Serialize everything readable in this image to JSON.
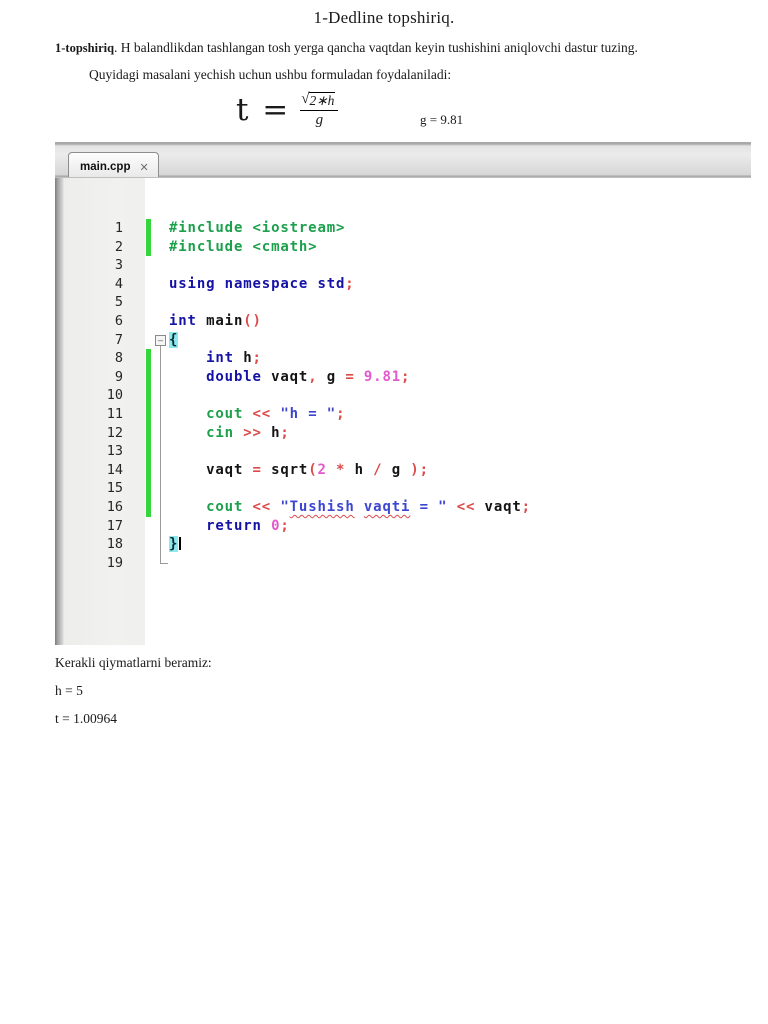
{
  "page": {
    "title": "1-Dedline topshiriq.",
    "task_label": "1-topshiriq",
    "task_text": ". H balandlikdan tashlangan tosh yerga qancha vaqtdan keyin tushishini aniqlovchi dastur tuzing.",
    "hint_text": "Quyidagi masalani yechish uchun ushbu formuladan foydalaniladi:",
    "formula": {
      "lhs": "t =",
      "radical": "√",
      "numerator": "2∗h",
      "denominator": "g",
      "constant": "g = 9.81"
    },
    "results": {
      "intro": "Kerakli qiymatlarni beramiz:",
      "h_value": "h = 5",
      "t_value": "t = 1.00964"
    }
  },
  "ide": {
    "tab": {
      "label": "main.cpp",
      "close_icon": "✕"
    },
    "colors": {
      "preprocessor_green": "#1ca04c",
      "keyword_navy": "#1512a6",
      "operator_red": "#dc4a4a",
      "number_magenta": "#e259ce",
      "string_blue": "#3c46d0",
      "identifier_black": "#141414",
      "brace_highlight_cyan": "#8be9f0",
      "change_bar_green": "#36d53c",
      "gutter_gray": "#f1f1f0"
    },
    "lines": [
      {
        "n": "1",
        "m": true,
        "t": [
          {
            "c": "g",
            "x": "#include <iostream>"
          }
        ]
      },
      {
        "n": "2",
        "m": true,
        "t": [
          {
            "c": "g",
            "x": "#include <cmath>"
          }
        ]
      },
      {
        "n": "3",
        "t": []
      },
      {
        "n": "4",
        "t": [
          {
            "c": "k",
            "x": "using namespace std"
          },
          {
            "c": "o",
            "x": ";"
          }
        ]
      },
      {
        "n": "5",
        "t": []
      },
      {
        "n": "6",
        "t": [
          {
            "c": "k",
            "x": "int"
          },
          {
            "c": "i",
            "x": " main"
          },
          {
            "c": "o",
            "x": "()"
          }
        ]
      },
      {
        "n": "7",
        "f": "box",
        "t": [
          {
            "c": "hl",
            "x": "{"
          }
        ]
      },
      {
        "n": "8",
        "m": true,
        "f": "line",
        "t": [
          {
            "c": "i",
            "x": "    "
          },
          {
            "c": "k",
            "x": "int"
          },
          {
            "c": "i",
            "x": " h"
          },
          {
            "c": "o",
            "x": ";"
          }
        ]
      },
      {
        "n": "9",
        "m": true,
        "f": "line",
        "t": [
          {
            "c": "i",
            "x": "    "
          },
          {
            "c": "k",
            "x": "double"
          },
          {
            "c": "i",
            "x": " vaqt"
          },
          {
            "c": "o",
            "x": ","
          },
          {
            "c": "i",
            "x": " g "
          },
          {
            "c": "o",
            "x": "="
          },
          {
            "c": "i",
            "x": " "
          },
          {
            "c": "n",
            "x": "9.81"
          },
          {
            "c": "o",
            "x": ";"
          }
        ]
      },
      {
        "n": "10",
        "m": true,
        "f": "line",
        "t": []
      },
      {
        "n": "11",
        "m": true,
        "f": "line",
        "t": [
          {
            "c": "i",
            "x": "    "
          },
          {
            "c": "g",
            "x": "cout"
          },
          {
            "c": "i",
            "x": " "
          },
          {
            "c": "o",
            "x": "<<"
          },
          {
            "c": "i",
            "x": " "
          },
          {
            "c": "s",
            "x": "\"h = \""
          },
          {
            "c": "o",
            "x": ";"
          }
        ]
      },
      {
        "n": "12",
        "m": true,
        "f": "line",
        "t": [
          {
            "c": "i",
            "x": "    "
          },
          {
            "c": "g",
            "x": "cin"
          },
          {
            "c": "i",
            "x": " "
          },
          {
            "c": "o",
            "x": ">>"
          },
          {
            "c": "i",
            "x": " h"
          },
          {
            "c": "o",
            "x": ";"
          }
        ]
      },
      {
        "n": "13",
        "m": true,
        "f": "line",
        "t": []
      },
      {
        "n": "14",
        "m": true,
        "f": "line",
        "t": [
          {
            "c": "i",
            "x": "    vaqt "
          },
          {
            "c": "o",
            "x": "="
          },
          {
            "c": "i",
            "x": " sqrt"
          },
          {
            "c": "o",
            "x": "("
          },
          {
            "c": "n",
            "x": "2"
          },
          {
            "c": "i",
            "x": " "
          },
          {
            "c": "o",
            "x": "*"
          },
          {
            "c": "i",
            "x": " h "
          },
          {
            "c": "o",
            "x": "/"
          },
          {
            "c": "i",
            "x": " g "
          },
          {
            "c": "o",
            "x": ")"
          },
          {
            "c": "o",
            "x": ";"
          }
        ]
      },
      {
        "n": "15",
        "m": true,
        "f": "line",
        "t": []
      },
      {
        "n": "16",
        "m": true,
        "f": "line",
        "t": [
          {
            "c": "i",
            "x": "    "
          },
          {
            "c": "g",
            "x": "cout"
          },
          {
            "c": "i",
            "x": " "
          },
          {
            "c": "o",
            "x": "<<"
          },
          {
            "c": "i",
            "x": " "
          },
          {
            "c": "s",
            "x": "\""
          },
          {
            "c": "sq",
            "x": "Tushish"
          },
          {
            "c": "s",
            "x": " "
          },
          {
            "c": "sq",
            "x": "vaqti"
          },
          {
            "c": "s",
            "x": " = \""
          },
          {
            "c": "i",
            "x": " "
          },
          {
            "c": "o",
            "x": "<<"
          },
          {
            "c": "i",
            "x": " vaqt"
          },
          {
            "c": "o",
            "x": ";"
          }
        ]
      },
      {
        "n": "17",
        "f": "line",
        "t": [
          {
            "c": "i",
            "x": "    "
          },
          {
            "c": "k",
            "x": "return"
          },
          {
            "c": "i",
            "x": " "
          },
          {
            "c": "n",
            "x": "0"
          },
          {
            "c": "o",
            "x": ";"
          }
        ]
      },
      {
        "n": "18",
        "f": "line",
        "cursor": true,
        "t": [
          {
            "c": "hl",
            "x": "}"
          }
        ]
      },
      {
        "n": "19",
        "f": "corner",
        "t": []
      }
    ]
  }
}
